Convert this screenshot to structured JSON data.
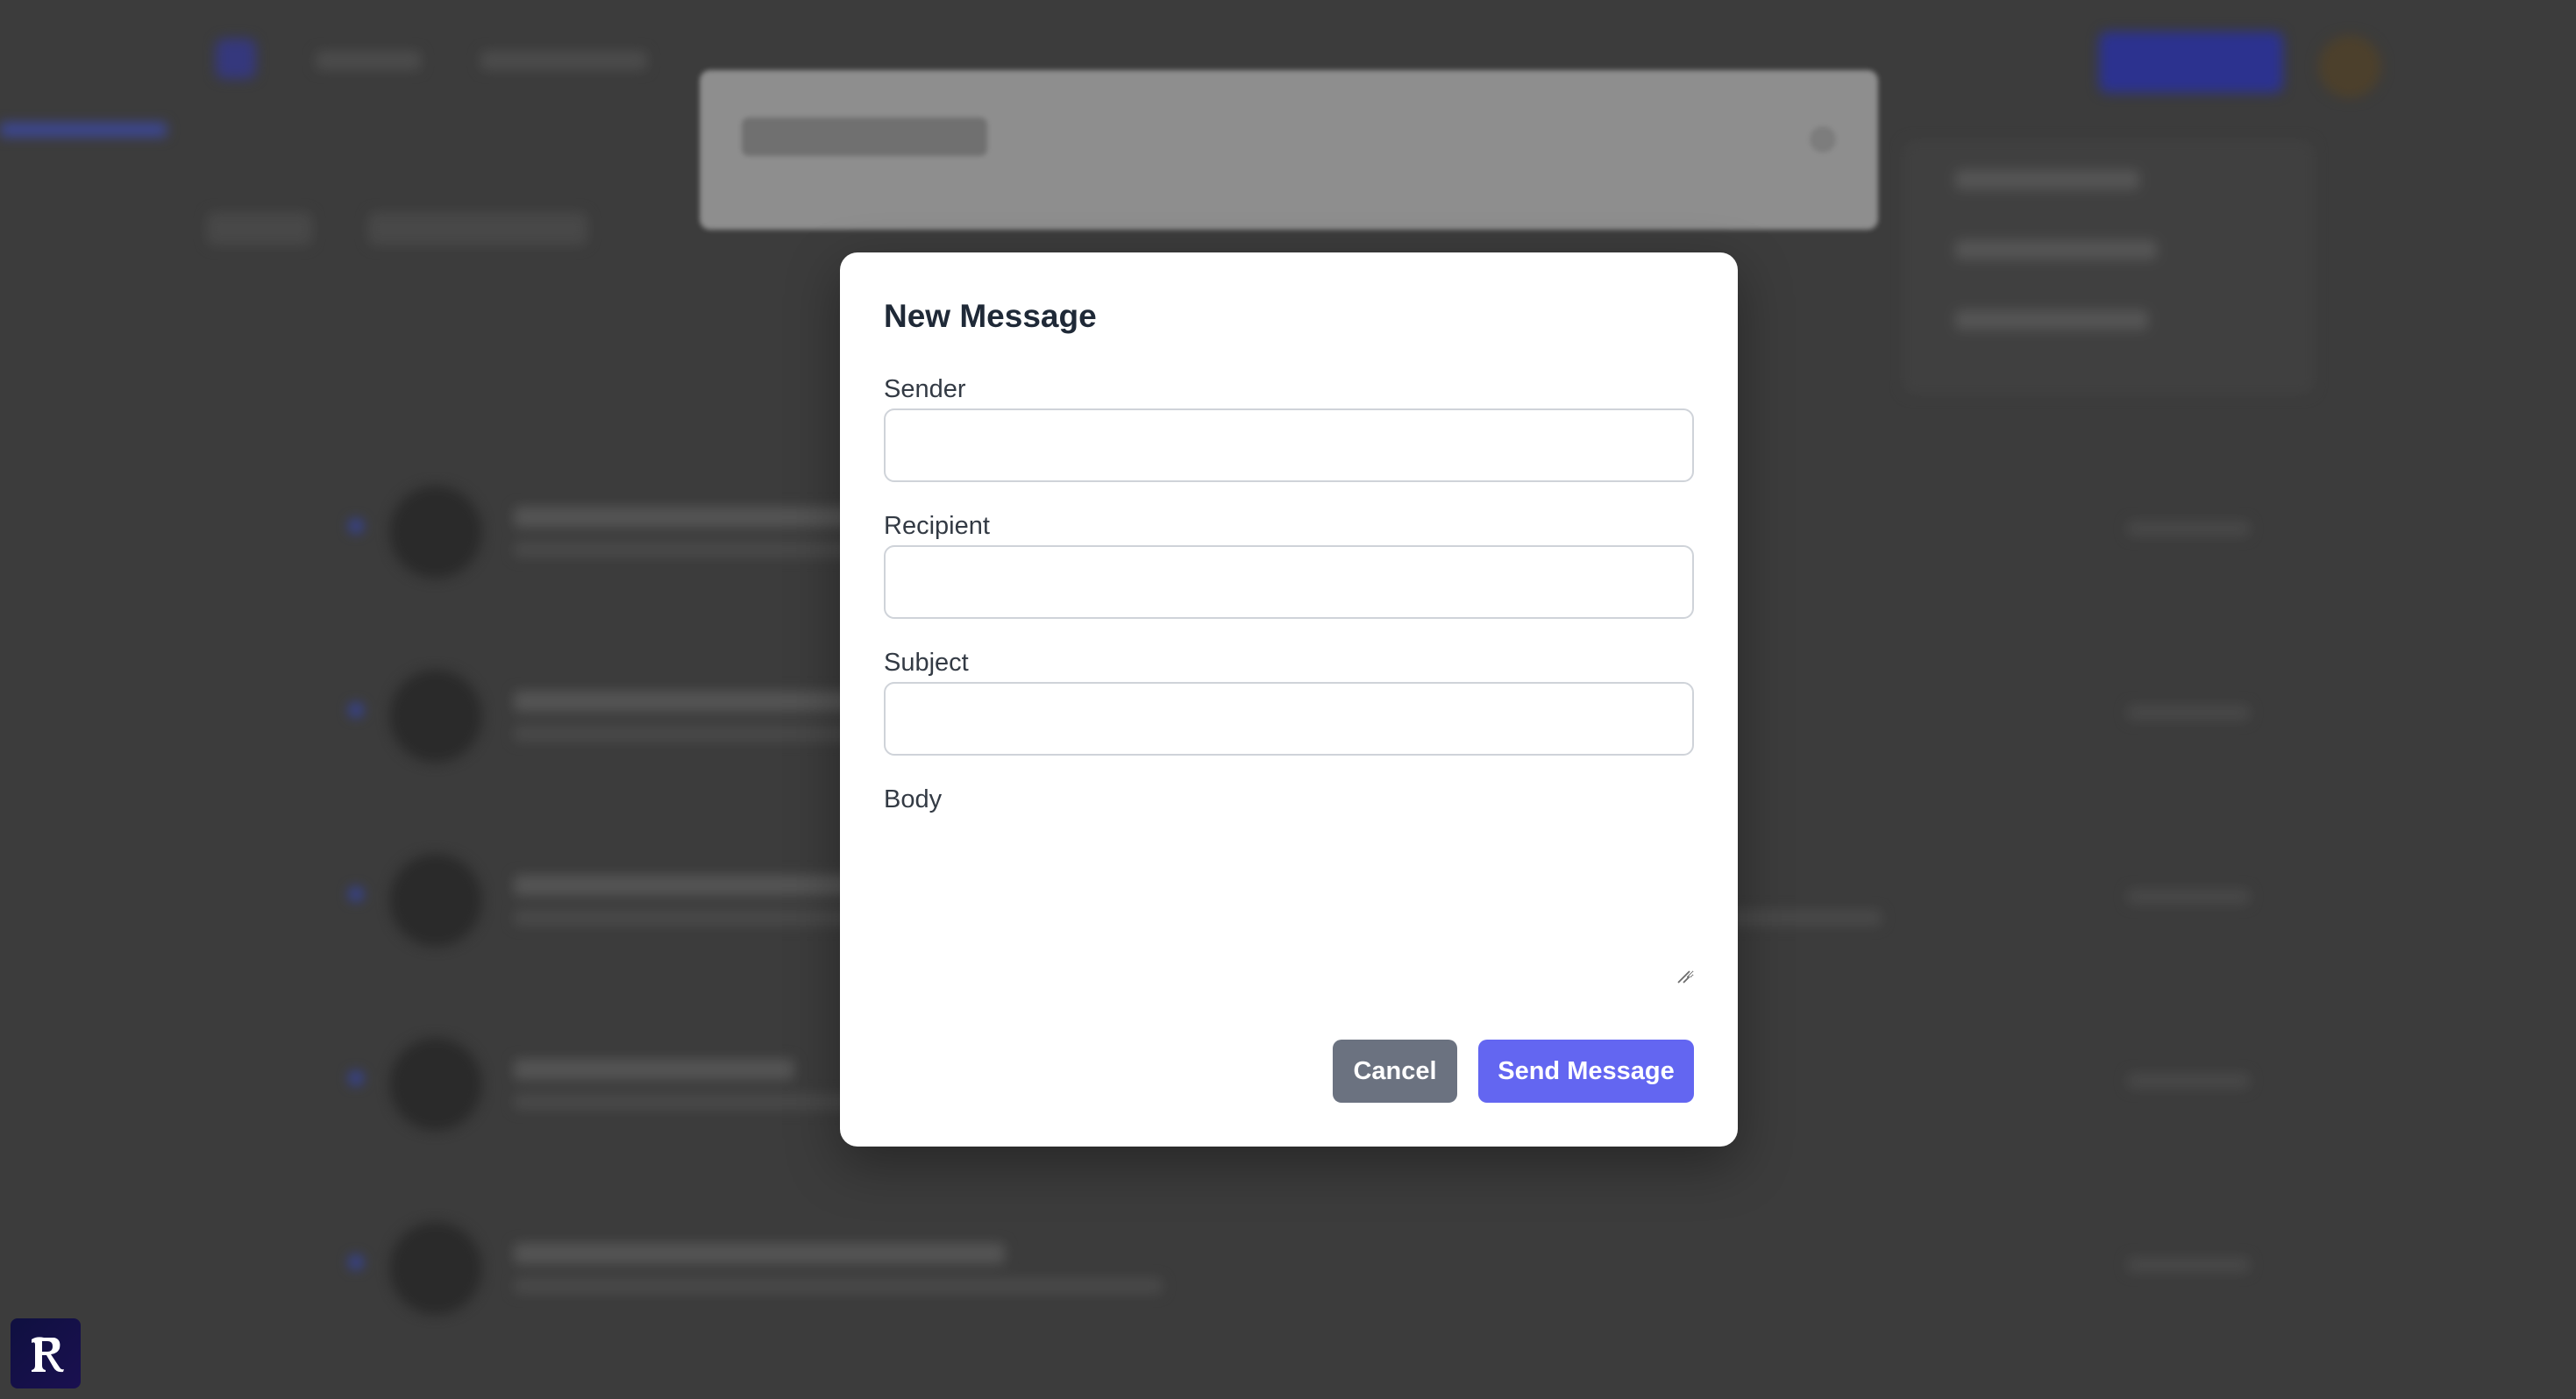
{
  "modal": {
    "title": "New Message",
    "fields": {
      "sender": {
        "label": "Sender",
        "value": "",
        "placeholder": ""
      },
      "recipient": {
        "label": "Recipient",
        "value": "",
        "placeholder": ""
      },
      "subject": {
        "label": "Subject",
        "value": "",
        "placeholder": ""
      },
      "body": {
        "label": "Body",
        "value": "",
        "placeholder": ""
      }
    },
    "buttons": {
      "cancel_label": "Cancel",
      "send_label": "Send Message"
    }
  },
  "colors": {
    "primary_button": "#6366f1",
    "secondary_button": "#6b7280",
    "modal_background": "#ffffff",
    "backdrop": "#3a3a3a"
  },
  "icons": {
    "corner_badge": "gothic-r-logo-icon",
    "textarea_grip": "resize-grip-icon"
  }
}
